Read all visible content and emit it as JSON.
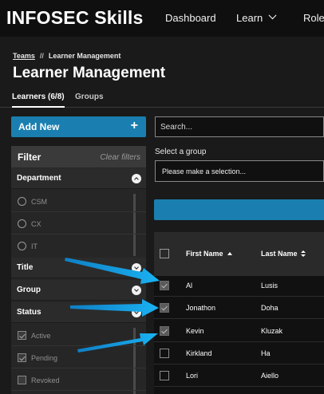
{
  "header": {
    "logo": "INFOSEC Skills",
    "nav": [
      {
        "label": "Dashboard"
      },
      {
        "label": "Learn"
      },
      {
        "label": "Roles"
      }
    ]
  },
  "breadcrumb": {
    "link": "Teams",
    "separator": "//",
    "current": "Learner Management"
  },
  "page": {
    "title": "Learner Management"
  },
  "tabs": [
    {
      "label": "Learners (6/8)",
      "active": true
    },
    {
      "label": "Groups",
      "active": false
    }
  ],
  "add_button": {
    "label": "Add New",
    "icon": "plus-icon"
  },
  "filter": {
    "title": "Filter",
    "clear_label": "Clear filters",
    "department": {
      "label": "Department",
      "expanded": true,
      "options": [
        {
          "label": "CSM",
          "selected": false
        },
        {
          "label": "CX",
          "selected": false
        },
        {
          "label": "IT",
          "selected": false
        }
      ]
    },
    "title_section": {
      "label": "Title",
      "expanded": false
    },
    "group_section": {
      "label": "Group",
      "expanded": false
    },
    "status": {
      "label": "Status",
      "expanded": false,
      "options": [
        {
          "label": "Active",
          "checked": true
        },
        {
          "label": "Pending",
          "checked": true
        },
        {
          "label": "Revoked",
          "checked": false
        }
      ]
    }
  },
  "search": {
    "placeholder": "Search..."
  },
  "group_select": {
    "label": "Select a group",
    "value": "Please make a selection..."
  },
  "table": {
    "columns": [
      {
        "label": "First Name",
        "sort": "ascending"
      },
      {
        "label": "Last Name",
        "sort": "both"
      }
    ],
    "rows": [
      {
        "first": "Al",
        "last": "Lusis",
        "checked": true
      },
      {
        "first": "Jonathon",
        "last": "Doha",
        "checked": true
      },
      {
        "first": "Kevin",
        "last": "Kluzak",
        "checked": true
      },
      {
        "first": "Kirkland",
        "last": "Ha",
        "checked": false
      },
      {
        "first": "Lori",
        "last": "Aiello",
        "checked": false
      }
    ]
  },
  "colors": {
    "accent": "#1a7fb0",
    "annotation_arrow": "#1aa3e8",
    "background": "#1a1a1a"
  }
}
